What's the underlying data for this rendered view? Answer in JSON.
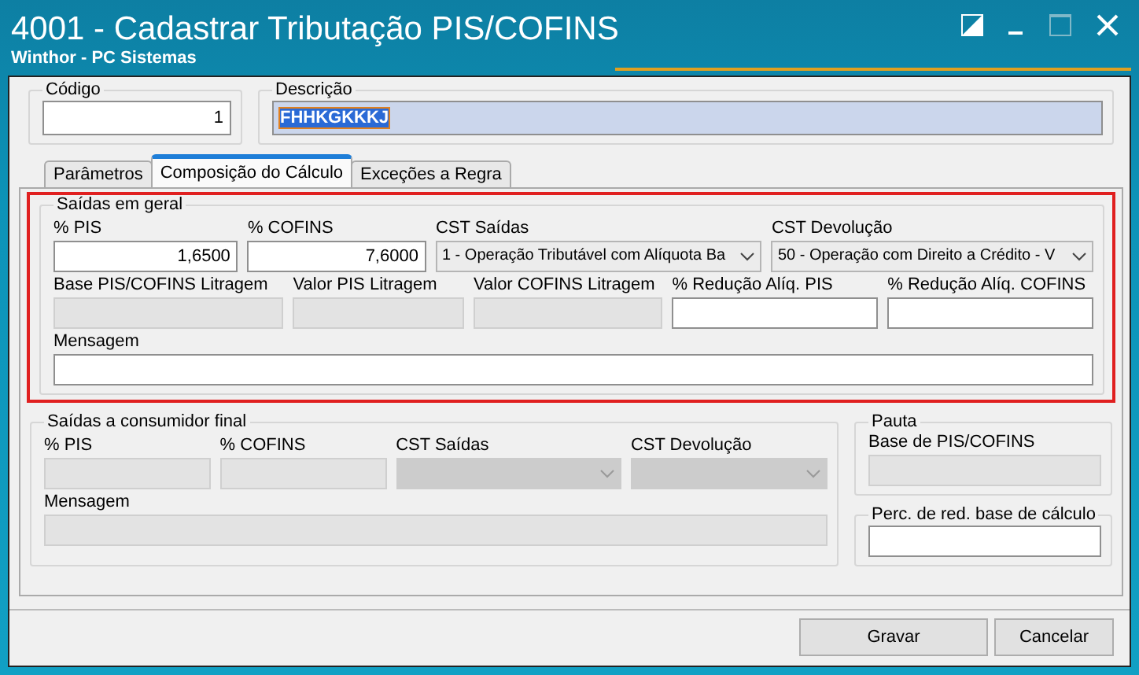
{
  "window": {
    "title": "4001 - Cadastrar Tributação PIS/COFINS",
    "subtitle": "Winthor - PC Sistemas"
  },
  "header": [
    {
      "label": "Código",
      "value": "1",
      "selected": false
    },
    {
      "label": "Descrição",
      "value": "FHHKGKKKJ",
      "selected": true
    }
  ],
  "tabs": [
    {
      "label": "Parâmetros",
      "selected": false
    },
    {
      "label": "Composição do Cálculo",
      "selected": true
    },
    {
      "label": "Exceções a Regra",
      "selected": false
    }
  ],
  "general": {
    "title": "Saídas em geral",
    "highlighted": true,
    "rows": [
      [
        {
          "label": "% PIS",
          "kind": "text",
          "value": "1,6500",
          "disabled": false
        },
        {
          "label": "% COFINS",
          "kind": "text",
          "value": "7,6000",
          "disabled": false
        },
        {
          "label": "CST Saídas",
          "kind": "select",
          "value": "1 - Operação Tributável com Alíquota Ba",
          "disabled": false
        },
        {
          "label": "CST Devolução",
          "kind": "select",
          "value": "50 - Operação com Direito a Crédito - V",
          "disabled": false
        }
      ],
      [
        {
          "label": "Base PIS/COFINS Litragem",
          "kind": "text",
          "disabled": true
        },
        {
          "label": "Valor PIS Litragem",
          "kind": "text",
          "disabled": true
        },
        {
          "label": "Valor COFINS Litragem",
          "kind": "text",
          "disabled": true
        },
        {
          "label": "% Redução Alíq. PIS",
          "kind": "text",
          "disabled": false
        },
        {
          "label": "% Redução Alíq. COFINS",
          "kind": "text",
          "disabled": false
        }
      ],
      [
        {
          "label": "Mensagem",
          "kind": "text",
          "disabled": false
        }
      ]
    ]
  },
  "final": {
    "title": "Saídas a consumidor final",
    "rows": [
      [
        {
          "label": "% PIS",
          "kind": "text",
          "disabled": true
        },
        {
          "label": "% COFINS",
          "kind": "text",
          "disabled": true
        },
        {
          "label": "CST Saídas",
          "kind": "select",
          "disabled": true
        },
        {
          "label": "CST Devolução",
          "kind": "select",
          "disabled": true
        }
      ],
      [
        {
          "label": "Mensagem",
          "kind": "text",
          "disabled": true
        }
      ]
    ]
  },
  "pauta": {
    "title": "Pauta",
    "field": {
      "label": "Base de PIS/COFINS",
      "kind": "text",
      "disabled": true
    }
  },
  "reduction": {
    "title": "Perc. de red. base de cálculo",
    "field": {
      "kind": "text",
      "disabled": false
    }
  },
  "buttons": [
    "Gravar",
    "Cancelar"
  ]
}
